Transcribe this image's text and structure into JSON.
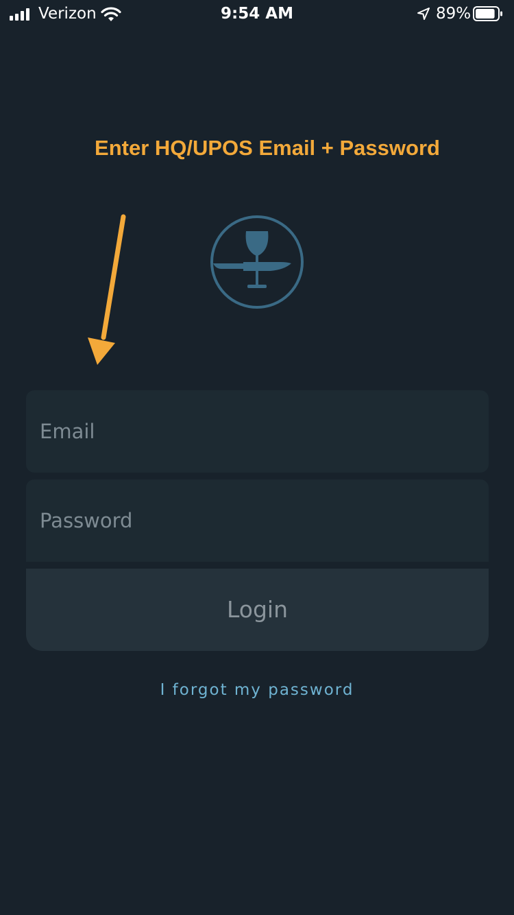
{
  "status_bar": {
    "carrier": "Verizon",
    "time": "9:54 AM",
    "battery_percent": "89%",
    "battery_level": 0.89,
    "icons": [
      "signal-icon",
      "wifi-icon",
      "location-arrow-icon",
      "battery-icon"
    ]
  },
  "annotation": {
    "text": "Enter HQ/UPOS Email + Password",
    "color": "#f3a93a"
  },
  "logo": {
    "icon": "wine-glass-knife-icon",
    "color": "#3a6a85"
  },
  "login_form": {
    "email_placeholder": "Email",
    "email_value": "",
    "password_placeholder": "Password",
    "password_value": "",
    "login_label": "Login",
    "forgot_password_label": "I forgot my password"
  },
  "colors": {
    "background": "#18222b",
    "field_background": "#1d2a32",
    "button_background": "#25323b",
    "link": "#6fb3d2"
  }
}
